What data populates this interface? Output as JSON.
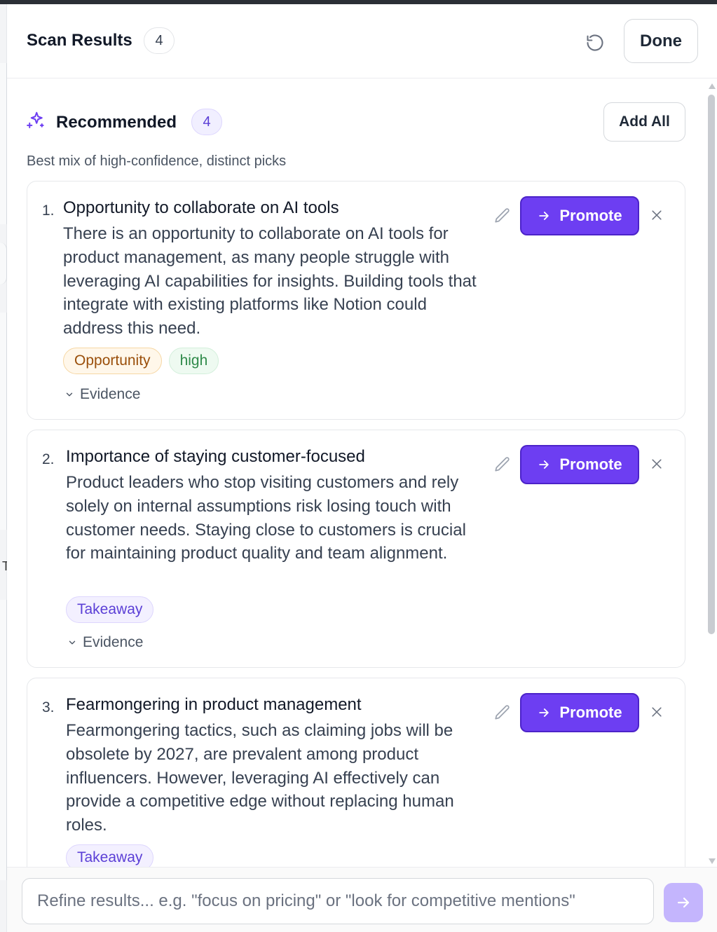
{
  "header": {
    "title": "Scan Results",
    "count": "4",
    "refresh_icon": "refresh-icon",
    "done_label": "Done"
  },
  "recommended": {
    "icon": "sparkles-icon",
    "title": "Recommended",
    "count": "4",
    "add_all_label": "Add All",
    "subtitle": "Best mix of high-confidence, distinct picks"
  },
  "items": [
    {
      "number": "1.",
      "title": "Opportunity to collaborate on AI tools",
      "body": "There is an opportunity to collaborate on AI tools for product management, as many people struggle with leveraging AI capabilities for insights. Building tools that integrate with existing platforms like Notion could address this need.",
      "tags": [
        "Opportunity",
        "high"
      ],
      "evidence_label": "Evidence",
      "promote_label": "Promote"
    },
    {
      "number": "2.",
      "title": "Importance of staying customer-focused",
      "body": "Product leaders who stop visiting customers and rely solely on internal assumptions risk losing touch with customer needs. Staying close to customers is crucial for maintaining product quality and team alignment.",
      "tags": [
        "Takeaway"
      ],
      "evidence_label": "Evidence",
      "promote_label": "Promote"
    },
    {
      "number": "3.",
      "title": "Fearmongering in product management",
      "body": "Fearmongering tactics, such as claiming jobs will be obsolete by 2027, are prevalent among product influencers. However, leveraging AI effectively can provide a competitive edge without replacing human roles.",
      "tags": [
        "Takeaway"
      ],
      "promote_label": "Promote"
    }
  ],
  "refine": {
    "value": "",
    "placeholder": "Refine results... e.g. \"focus on pricing\" or \"look for competitive mentions\""
  },
  "colors": {
    "accent": "#6d3ef2",
    "accent_border": "#4c23c9",
    "send_disabled": "#c4b5fd",
    "opportunity_tag": "#9a4f0b",
    "high_tag": "#2f8a4a",
    "takeaway_tag": "#5b3fd6"
  }
}
